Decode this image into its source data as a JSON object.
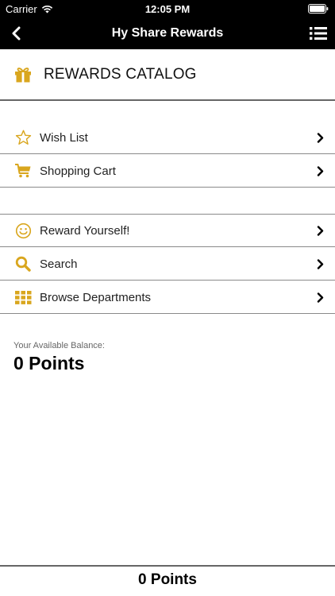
{
  "status_bar": {
    "carrier": "Carrier",
    "time": "12:05 PM"
  },
  "nav": {
    "title": "Hy Share Rewards"
  },
  "catalog": {
    "title": "REWARDS CATALOG",
    "icon": "gift-icon"
  },
  "menu_group_1": [
    {
      "label": "Wish List",
      "icon": "star-icon"
    },
    {
      "label": "Shopping Cart",
      "icon": "cart-icon"
    }
  ],
  "menu_group_2": [
    {
      "label": "Reward Yourself!",
      "icon": "smiley-icon"
    },
    {
      "label": "Search",
      "icon": "search-icon"
    },
    {
      "label": "Browse Departments",
      "icon": "grid-icon"
    }
  ],
  "balance": {
    "label": "Your Available Balance:",
    "value": "0 Points"
  },
  "footer": {
    "points": "0 Points"
  },
  "colors": {
    "accent": "#d9a61e",
    "bar": "#000000",
    "divider": "#8a8a8a"
  }
}
